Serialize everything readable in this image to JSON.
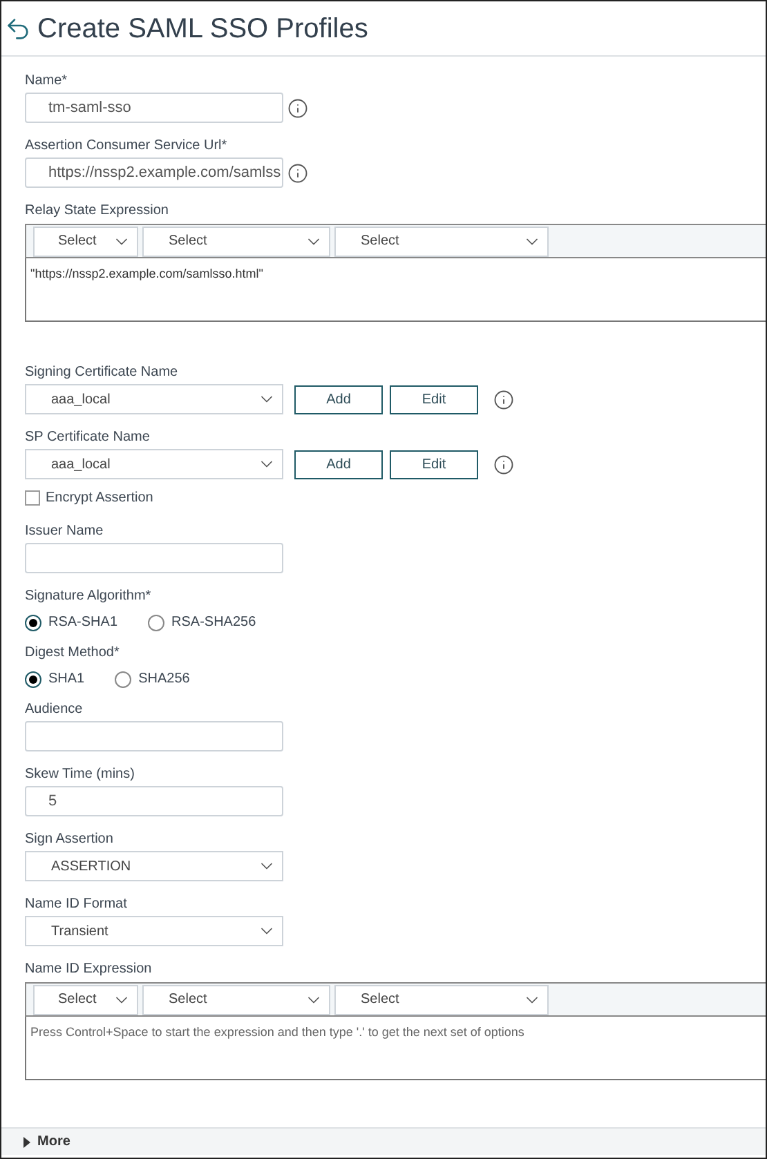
{
  "title": "Create SAML SSO Profiles",
  "fields": [
    {
      "kind": "text",
      "label": "Name*",
      "value": "tm-saml-sso",
      "info": true
    },
    {
      "kind": "text",
      "label": "Assertion Consumer Service Url*",
      "value": "https://nssp2.example.com/samlss",
      "info": true
    },
    {
      "kind": "expression",
      "label": "Relay State Expression",
      "selects": [
        "Select",
        "Select",
        "Select"
      ],
      "value": "\"https://nssp2.example.com/samlsso.html\""
    },
    {
      "kind": "select_actions",
      "label": "Signing Certificate Name",
      "value": "aaa_local",
      "actions": [
        "Add",
        "Edit"
      ],
      "info": true
    },
    {
      "kind": "select_actions",
      "label": "SP Certificate Name",
      "value": "aaa_local",
      "actions": [
        "Add",
        "Edit"
      ],
      "info": true
    },
    {
      "kind": "checkbox",
      "label": "Encrypt Assertion",
      "checked": false
    },
    {
      "kind": "text",
      "label": "Issuer Name",
      "info": false
    },
    {
      "kind": "radio",
      "label": "Signature Algorithm*",
      "options": [
        {
          "label": "RSA-SHA1",
          "selected": true
        },
        {
          "label": "RSA-SHA256",
          "selected": false
        }
      ]
    },
    {
      "kind": "radio",
      "label": "Digest Method*",
      "options": [
        {
          "label": "SHA1",
          "selected": true
        },
        {
          "label": "SHA256",
          "selected": false
        }
      ]
    },
    {
      "kind": "text",
      "label": "Audience",
      "info": false
    },
    {
      "kind": "text",
      "label": "Skew Time (mins)",
      "value": "5",
      "info": false
    },
    {
      "kind": "select",
      "label": "Sign Assertion",
      "value": "ASSERTION"
    },
    {
      "kind": "select",
      "label": "Name ID Format",
      "value": "Transient"
    },
    {
      "kind": "expression",
      "label": "Name ID Expression",
      "selects": [
        "Select",
        "Select",
        "Select"
      ],
      "placeholder": "Press Control+Space to start the expression and then type '.' to get the next set of options"
    }
  ],
  "more": {
    "label": "More",
    "expanded": false
  }
}
